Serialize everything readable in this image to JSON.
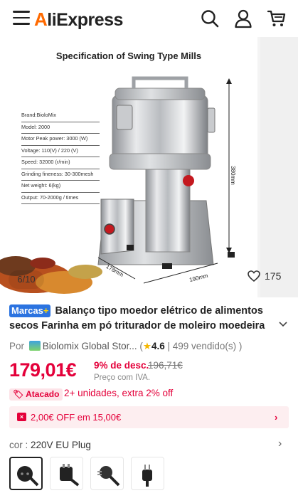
{
  "header": {
    "logo": "AliExpress",
    "logo_first": "A",
    "logo_rest": "liExpress"
  },
  "gallery": {
    "spec_title": "Specification of Swing Type Mills",
    "specs": [
      "Brand:BioloMix",
      "Model:  2000",
      "Motor Peak power: 3000 (W)",
      "Voltage: 110(V) / 220 (V)",
      "Speed: 32000 (r/min)",
      "Grinding fineness: 30-300mesh",
      "Net weight: 6(kg)",
      "Output: 70-2000g / times"
    ],
    "dim_height": "380mm",
    "dim_depth": "178mm",
    "dim_width": "190mm",
    "page_indicator": "6/10",
    "wishlist_count": "175"
  },
  "product": {
    "badge": "Marcas",
    "badge_plus": "+",
    "title": "Balanço tipo moedor elétrico de alimentos secos Farinha em pó triturador de moleiro moedeira",
    "store_prefix": "Por",
    "store_name": "Biolomix Global Stor...",
    "rating": "4.6",
    "sold": "499 vendido(s)",
    "price": "179,01€",
    "discount": "9% de desc.",
    "old_price": "196,71€",
    "vat_note": "Preço com IVA.",
    "atacado_label": "Atacado",
    "atacado_text": "2+ unidades, extra 2% off",
    "coupon_text": "2,00€ OFF em 15,00€",
    "color_label": "cor :",
    "color_value": "220V EU Plug"
  },
  "colors": {
    "accent": "#e4003a",
    "brand_orange": "#ff6a00",
    "badge_blue": "#2b73e0"
  }
}
